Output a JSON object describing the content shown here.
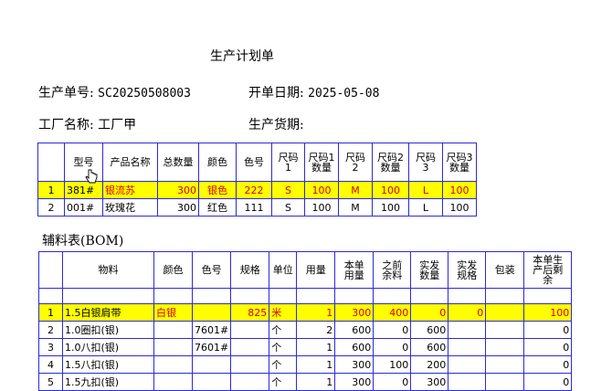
{
  "doc_title": "生产计划单",
  "order_no_label": "生产单号:",
  "order_no": "SC20250508003",
  "order_date_label": "开单日期:",
  "order_date": "2025-05-08",
  "factory_label": "工厂名称:",
  "factory": "工厂甲",
  "delivery_label": "生产货期:",
  "delivery": "",
  "product_table": {
    "headers": [
      "",
      "型号",
      "产品名称",
      "总数量",
      "颜色",
      "色号",
      "尺码\n1",
      "尺码1\n数量",
      "尺码\n2",
      "尺码2\n数量",
      "尺码\n3",
      "尺码3\n数量"
    ],
    "rows": [
      [
        "1",
        "381#",
        "银流苏",
        "300",
        "银色",
        "222",
        "S",
        "100",
        "M",
        "100",
        "L",
        "100"
      ],
      [
        "2",
        "001#",
        "玫瑰花",
        "300",
        "红色",
        "111",
        "S",
        "100",
        "M",
        "100",
        "L",
        "100"
      ]
    ]
  },
  "bom_title": "辅料表(BOM)",
  "bom_table": {
    "headers": [
      "",
      "物料",
      "颜色",
      "色号",
      "规格",
      "单位",
      "用量",
      "本单\n用量",
      "之前\n余料",
      "实发\n数量",
      "实发\n规格",
      "包装",
      "本单生\n产后剩\n余"
    ],
    "rows": [
      [
        "1",
        "1.5白银肩带",
        "白银",
        "",
        "825",
        "米",
        "1",
        "300",
        "400",
        "0",
        "0",
        "",
        "100"
      ],
      [
        "2",
        "1.0圈扣(银)",
        "",
        "7601#",
        "",
        "个",
        "2",
        "600",
        "0",
        "600",
        "",
        "",
        "0"
      ],
      [
        "3",
        "1.0八扣(银)",
        "",
        "7601#",
        "",
        "个",
        "1",
        "600",
        "0",
        "600",
        "",
        "",
        "0"
      ],
      [
        "4",
        "1.5八扣(银)",
        "",
        "",
        "",
        "个",
        "1",
        "300",
        "100",
        "200",
        "",
        "",
        "0"
      ],
      [
        "5",
        "1.5九扣(银)",
        "",
        "",
        "",
        "个",
        "1",
        "300",
        "0",
        "300",
        "",
        "",
        "0"
      ]
    ]
  }
}
